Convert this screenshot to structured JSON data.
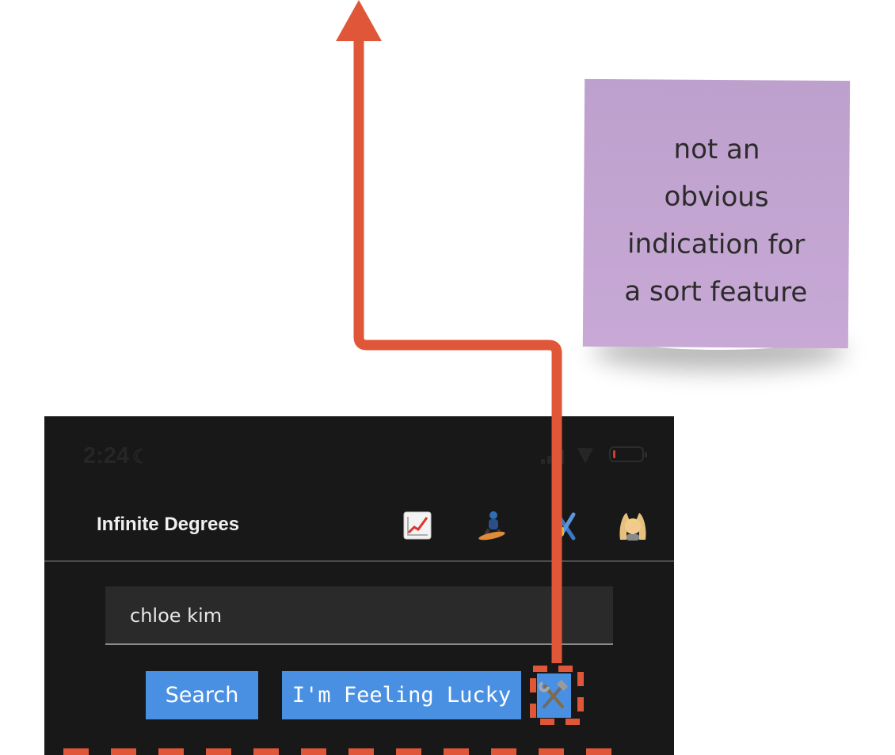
{
  "sticky_note": {
    "lines": [
      "not an",
      "obvious",
      "indication for",
      "a sort feature"
    ]
  },
  "status_bar": {
    "time": "2:24"
  },
  "app": {
    "title": "Infinite Degrees",
    "nav_icons": [
      "chart-increasing-icon",
      "snowboarder-icon",
      "skis-lock-icon",
      "person-gesturing-ok-icon"
    ]
  },
  "search": {
    "value": "chloe kim"
  },
  "buttons": {
    "search_label": "Search",
    "lucky_label": "I'm Feeling Lucky",
    "tools_icon": "hammer-and-wrench-icon"
  },
  "colors": {
    "annotation": "#e05638",
    "sticky": "#c3a6d3",
    "button": "#4a90e2",
    "background": "#181818"
  }
}
